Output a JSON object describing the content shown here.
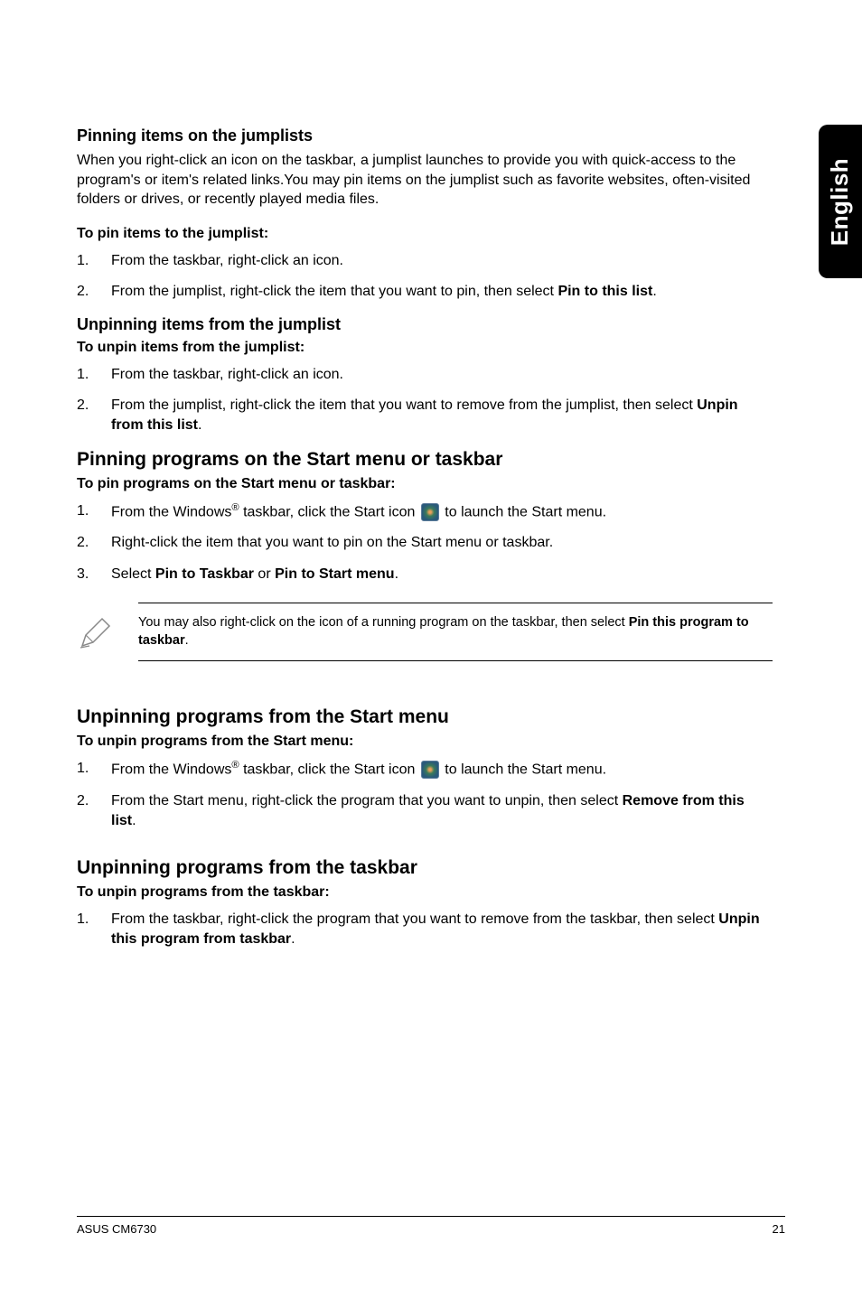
{
  "side_tab": "English",
  "sec1": {
    "title": "Pinning items on the jumplists",
    "intro": "When you right-click an icon on the taskbar, a jumplist launches to provide you with quick-access to the program's or item's related links.You may pin items on the jumplist such as favorite websites, often-visited folders or drives, or recently played media files.",
    "how_title": "To pin items to the jumplist:",
    "steps": [
      "From the taskbar, right-click an icon.",
      {
        "pre": "From the jumplist, right-click the item that you want to pin, then select ",
        "bold": "Pin to this list",
        "post": "."
      }
    ]
  },
  "sec2": {
    "title": "Unpinning items from the jumplist",
    "how_title": "To unpin items from the jumplist:",
    "steps": [
      "From the taskbar, right-click an icon.",
      {
        "pre": "From the jumplist, right-click the item that you want to remove from the jumplist, then select ",
        "bold": "Unpin from this list",
        "post": "."
      }
    ]
  },
  "sec3": {
    "title": "Pinning programs on the Start menu or taskbar",
    "how_title": "To pin programs on the Start menu or taskbar:",
    "step1_pre": "From the Windows",
    "step1_mid": " taskbar, click the Start icon ",
    "step1_post": " to launch the Start menu.",
    "step2": "Right-click the item that you want to pin on the Start menu or taskbar.",
    "step3_pre": "Select ",
    "step3_b1": "Pin to Taskbar",
    "step3_or": " or ",
    "step3_b2": "Pin to Start menu",
    "step3_post": "."
  },
  "note": {
    "pre": "You may also right-click on the icon of a running program on the taskbar, then select ",
    "bold": "Pin this program to taskbar",
    "post": "."
  },
  "sec4": {
    "title": "Unpinning programs from the Start menu",
    "how_title": "To unpin programs from the Start menu:",
    "step1_pre": "From the Windows",
    "step1_mid": " taskbar, click the Start icon ",
    "step1_post": " to launch the Start menu.",
    "step2_pre": "From the Start menu, right-click the program that you want to unpin, then select ",
    "step2_bold": "Remove from this list",
    "step2_post": "."
  },
  "sec5": {
    "title": "Unpinning programs from the taskbar",
    "how_title": "To unpin programs from the taskbar:",
    "step1_pre": "From the taskbar, right-click the program that you want to remove from the taskbar, then select ",
    "step1_bold": "Unpin this program from taskbar",
    "step1_post": "."
  },
  "footer": {
    "left": "ASUS CM6730",
    "right": "21"
  },
  "reg": "®"
}
